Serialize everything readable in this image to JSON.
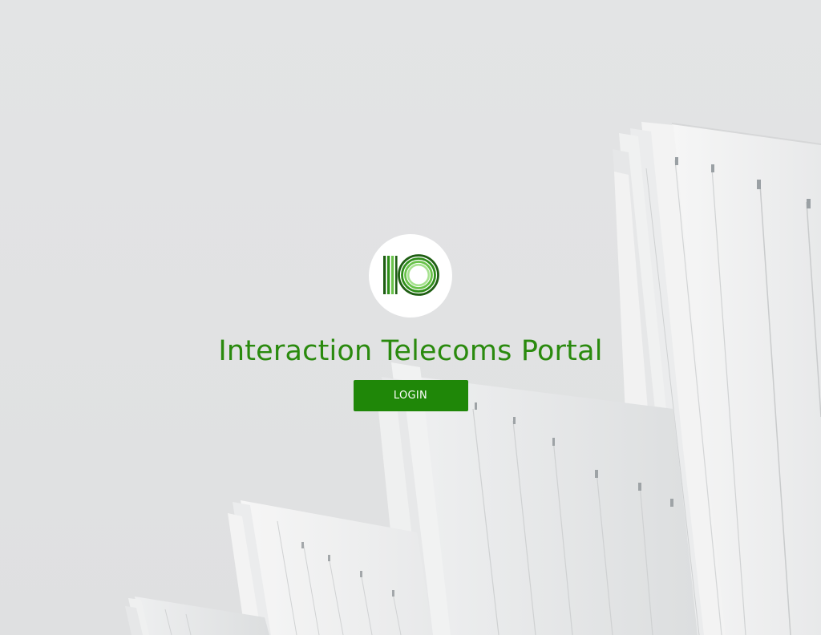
{
  "portal": {
    "title": "Interaction Telecoms Portal",
    "login_label": "LOGIN"
  },
  "logo": {
    "icon": "io-logo-icon",
    "colors": [
      "#1e5e12",
      "#2f8f1a",
      "#69c24a",
      "#a6e28f"
    ]
  },
  "colors": {
    "accent": "#1f8708",
    "title": "#2a8a0e",
    "background": "#e3e4e5"
  }
}
